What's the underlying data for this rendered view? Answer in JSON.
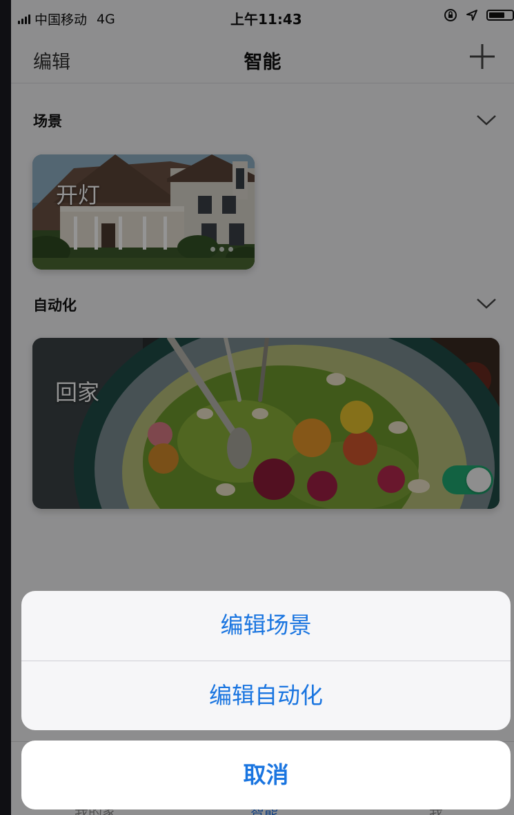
{
  "status_bar": {
    "carrier": "中国移动",
    "network": "4G",
    "time": "上午11:43"
  },
  "nav": {
    "edit_label": "编辑",
    "title": "智能",
    "add_icon": "plus-icon"
  },
  "scenes": {
    "header": "场景",
    "cards": [
      {
        "label": "开灯",
        "image": "house-photo"
      }
    ]
  },
  "automation": {
    "header": "自动化",
    "cards": [
      {
        "label": "回家",
        "image": "salad-photo",
        "enabled": true
      }
    ]
  },
  "tabs": [
    {
      "label": "我的家",
      "active": false
    },
    {
      "label": "智能",
      "active": true
    },
    {
      "label": "我",
      "active": false
    }
  ],
  "action_sheet": {
    "options": [
      "编辑场景",
      "编辑自动化"
    ],
    "cancel_label": "取消"
  },
  "colors": {
    "accent": "#1a75e0",
    "toggle_on": "#1faa72"
  }
}
